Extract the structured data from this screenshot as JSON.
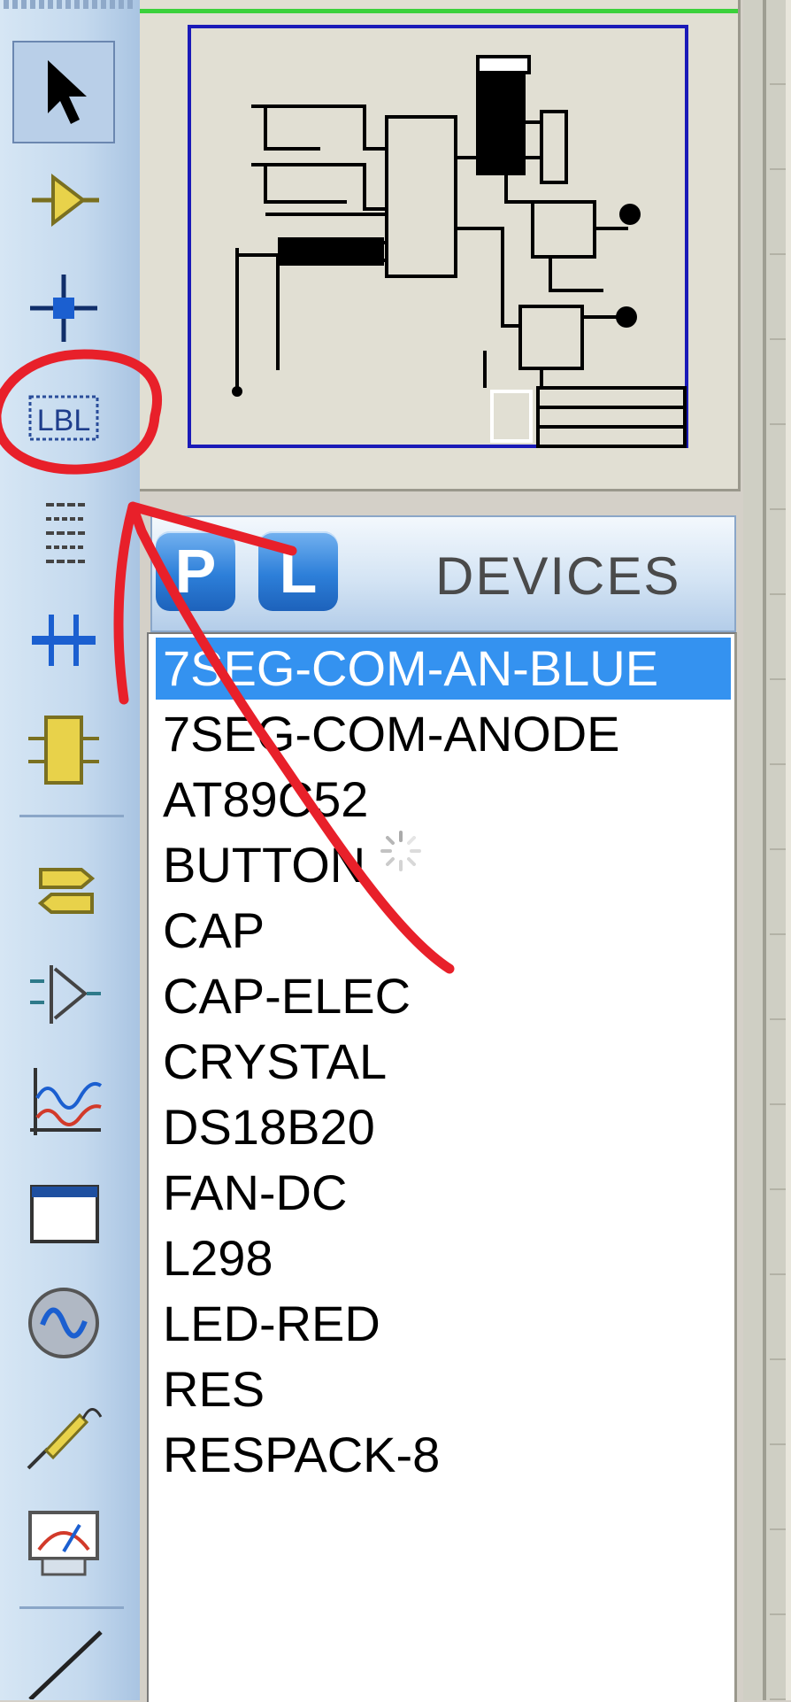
{
  "toolbar": {
    "tools": [
      {
        "name": "selection-mode",
        "icon": "cursor-arrow-icon",
        "active": true
      },
      {
        "name": "component-mode",
        "icon": "component-triangle-icon"
      },
      {
        "name": "junction-dot-mode",
        "icon": "junction-dot-icon"
      },
      {
        "name": "wire-label-mode",
        "icon": "wire-label-icon",
        "label": "LBL"
      },
      {
        "name": "text-script-mode",
        "icon": "text-script-icon"
      },
      {
        "name": "buses-mode",
        "icon": "bus-icon"
      },
      {
        "name": "subcircuit-mode",
        "icon": "subcircuit-icon"
      },
      {
        "name": "terminals-mode",
        "icon": "terminal-icon"
      },
      {
        "name": "device-pins-mode",
        "icon": "device-pin-icon"
      },
      {
        "name": "graph-mode",
        "icon": "graph-icon"
      },
      {
        "name": "tape-recorder-mode",
        "icon": "window-icon"
      },
      {
        "name": "generator-mode",
        "icon": "generator-sine-icon"
      },
      {
        "name": "voltage-probe-mode",
        "icon": "probe-icon"
      },
      {
        "name": "virtual-instruments-mode",
        "icon": "meter-icon"
      },
      {
        "name": "2d-line-mode",
        "icon": "line-icon"
      }
    ],
    "colors": {
      "accent": "#3492f0",
      "annotation": "#e8202a"
    }
  },
  "library": {
    "pick_button": "P",
    "libraries_button": "L",
    "title": "DEVICES",
    "selected_index": 0,
    "devices": [
      "7SEG-COM-AN-BLUE",
      "7SEG-COM-ANODE",
      "AT89C52",
      "BUTTON",
      "CAP",
      "CAP-ELEC",
      "CRYSTAL",
      "DS18B20",
      "FAN-DC",
      "L298",
      "LED-RED",
      "RES",
      "RESPACK-8"
    ]
  }
}
